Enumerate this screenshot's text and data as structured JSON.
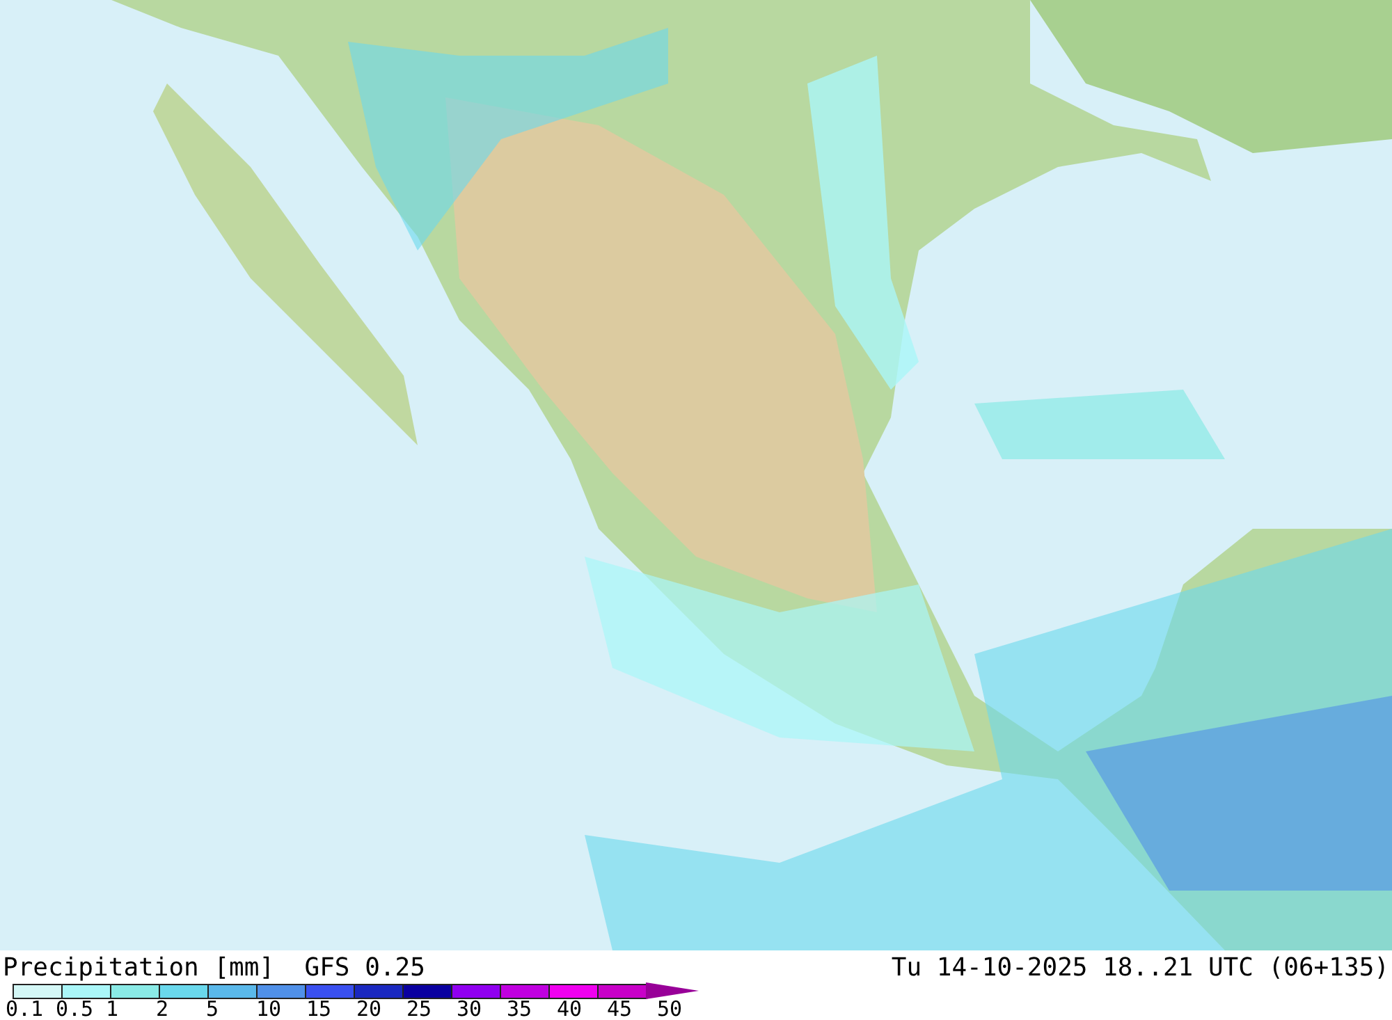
{
  "map": {
    "title": "Precipitation [mm]  GFS 0.25",
    "valid_time": "Tu 14-10-2025 18..21 UTC (06+135)"
  },
  "legend": {
    "steps": [
      {
        "label": "0.1",
        "color": "#d4f7f6"
      },
      {
        "label": "0.5",
        "color": "#aaf6f8"
      },
      {
        "label": "1",
        "color": "#8aeae6"
      },
      {
        "label": "2",
        "color": "#6ad8ec"
      },
      {
        "label": "5",
        "color": "#5ab8ea"
      },
      {
        "label": "10",
        "color": "#5090e8"
      },
      {
        "label": "15",
        "color": "#3a50f0"
      },
      {
        "label": "20",
        "color": "#1a28c0"
      },
      {
        "label": "25",
        "color": "#0a00a0"
      },
      {
        "label": "30",
        "color": "#9000f0"
      },
      {
        "label": "35",
        "color": "#c000e0"
      },
      {
        "label": "40",
        "color": "#f000f0"
      },
      {
        "label": "45",
        "color": "#c800c8"
      }
    ],
    "end_label": "50",
    "arrow": {
      "color": "#980098"
    }
  }
}
